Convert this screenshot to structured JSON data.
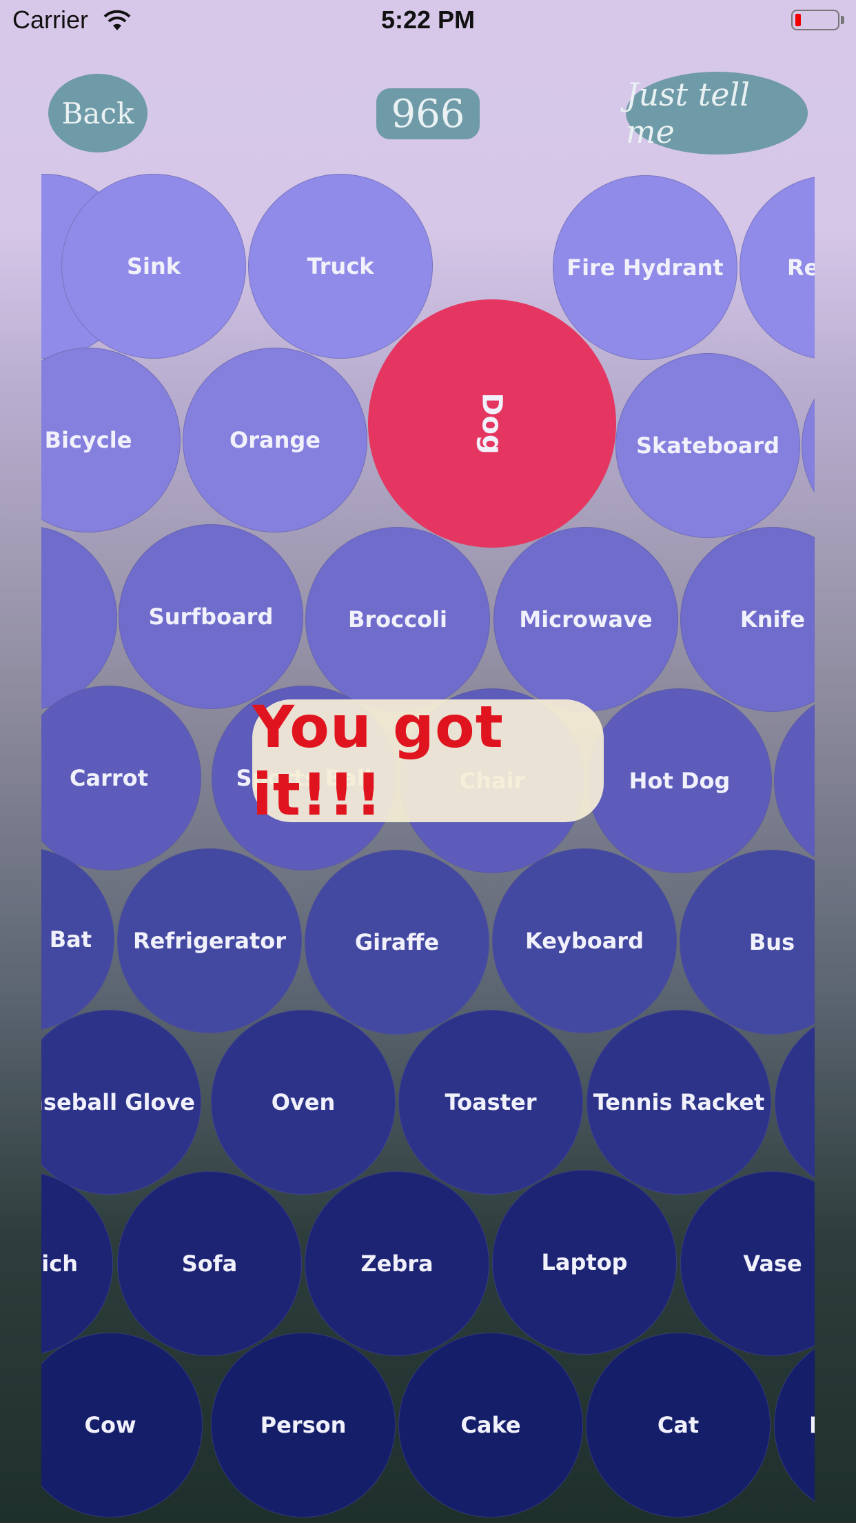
{
  "status": {
    "carrier": "Carrier",
    "time": "5:22 PM"
  },
  "nav": {
    "back": "Back",
    "score": "966",
    "tell": "Just tell me"
  },
  "bubbles": {
    "sink": "Sink",
    "truck": "Truck",
    "fire_hydrant": "Fire Hydrant",
    "re": "Re",
    "bicycle": "Bicycle",
    "orange": "Orange",
    "dog": "Dog",
    "skateboard": "Skateboard",
    "surfboard": "Surfboard",
    "broccoli": "Broccoli",
    "microwave": "Microwave",
    "knife": "Knife",
    "carrot": "Carrot",
    "sports_ball": "Sports Ball",
    "chair": "Chair",
    "hot_dog": "Hot Dog",
    "bat": "l Bat",
    "refrigerator": "Refrigerator",
    "giraffe": "Giraffe",
    "keyboard": "Keyboard",
    "bus": "Bus",
    "baseball_glove": "Baseball Glove",
    "oven": "Oven",
    "toaster": "Toaster",
    "tennis_racket": "Tennis Racket",
    "wich": "wich",
    "sofa": "Sofa",
    "zebra": "Zebra",
    "laptop": "Laptop",
    "vase": "Vase",
    "cow": "Cow",
    "person": "Person",
    "cake": "Cake",
    "cat": "Cat",
    "po": "Po"
  },
  "toast": "You got it!!!",
  "colors": {
    "correct_bubble": "#e43660",
    "toast_text": "#e0141f",
    "button": "#6f9aa7"
  }
}
